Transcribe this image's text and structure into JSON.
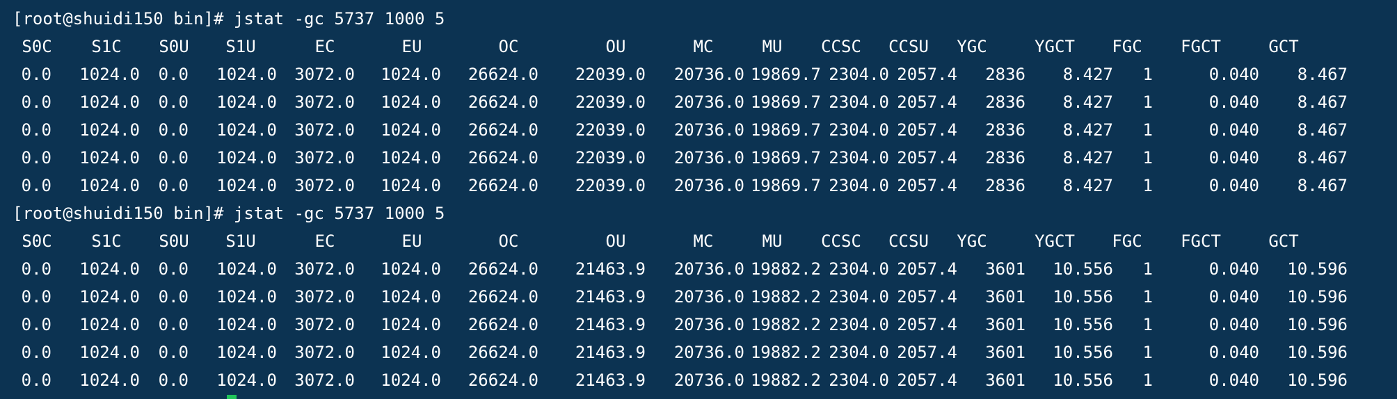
{
  "terminal": {
    "background": "#0c3352",
    "text_color": "#ffffff",
    "cursor_color": "#21c45a",
    "blocks": [
      {
        "prompt": "[root@shuidi150 bin]# jstat -gc 5737 1000 5",
        "headers": [
          "S0C",
          "S1C",
          "S0U",
          "S1U",
          "EC",
          "EU",
          "OC",
          "OU",
          "MC",
          "MU",
          "CCSC",
          "CCSU",
          "YGC",
          "YGCT",
          "FGC",
          "FGCT",
          "GCT"
        ],
        "rows": [
          [
            "0.0",
            "1024.0",
            "0.0",
            "1024.0",
            "3072.0",
            "1024.0",
            "26624.0",
            "22039.0",
            "20736.0",
            "19869.7",
            "2304.0",
            "2057.4",
            "2836",
            "8.427",
            "1",
            "0.040",
            "8.467"
          ],
          [
            "0.0",
            "1024.0",
            "0.0",
            "1024.0",
            "3072.0",
            "1024.0",
            "26624.0",
            "22039.0",
            "20736.0",
            "19869.7",
            "2304.0",
            "2057.4",
            "2836",
            "8.427",
            "1",
            "0.040",
            "8.467"
          ],
          [
            "0.0",
            "1024.0",
            "0.0",
            "1024.0",
            "3072.0",
            "1024.0",
            "26624.0",
            "22039.0",
            "20736.0",
            "19869.7",
            "2304.0",
            "2057.4",
            "2836",
            "8.427",
            "1",
            "0.040",
            "8.467"
          ],
          [
            "0.0",
            "1024.0",
            "0.0",
            "1024.0",
            "3072.0",
            "1024.0",
            "26624.0",
            "22039.0",
            "20736.0",
            "19869.7",
            "2304.0",
            "2057.4",
            "2836",
            "8.427",
            "1",
            "0.040",
            "8.467"
          ],
          [
            "0.0",
            "1024.0",
            "0.0",
            "1024.0",
            "3072.0",
            "1024.0",
            "26624.0",
            "22039.0",
            "20736.0",
            "19869.7",
            "2304.0",
            "2057.4",
            "2836",
            "8.427",
            "1",
            "0.040",
            "8.467"
          ]
        ]
      },
      {
        "prompt": "[root@shuidi150 bin]# jstat -gc 5737 1000 5",
        "headers": [
          "S0C",
          "S1C",
          "S0U",
          "S1U",
          "EC",
          "EU",
          "OC",
          "OU",
          "MC",
          "MU",
          "CCSC",
          "CCSU",
          "YGC",
          "YGCT",
          "FGC",
          "FGCT",
          "GCT"
        ],
        "rows": [
          [
            "0.0",
            "1024.0",
            "0.0",
            "1024.0",
            "3072.0",
            "1024.0",
            "26624.0",
            "21463.9",
            "20736.0",
            "19882.2",
            "2304.0",
            "2057.4",
            "3601",
            "10.556",
            "1",
            "0.040",
            "10.596"
          ],
          [
            "0.0",
            "1024.0",
            "0.0",
            "1024.0",
            "3072.0",
            "1024.0",
            "26624.0",
            "21463.9",
            "20736.0",
            "19882.2",
            "2304.0",
            "2057.4",
            "3601",
            "10.556",
            "1",
            "0.040",
            "10.596"
          ],
          [
            "0.0",
            "1024.0",
            "0.0",
            "1024.0",
            "3072.0",
            "1024.0",
            "26624.0",
            "21463.9",
            "20736.0",
            "19882.2",
            "2304.0",
            "2057.4",
            "3601",
            "10.556",
            "1",
            "0.040",
            "10.596"
          ],
          [
            "0.0",
            "1024.0",
            "0.0",
            "1024.0",
            "3072.0",
            "1024.0",
            "26624.0",
            "21463.9",
            "20736.0",
            "19882.2",
            "2304.0",
            "2057.4",
            "3601",
            "10.556",
            "1",
            "0.040",
            "10.596"
          ],
          [
            "0.0",
            "1024.0",
            "0.0",
            "1024.0",
            "3072.0",
            "1024.0",
            "26624.0",
            "21463.9",
            "20736.0",
            "19882.2",
            "2304.0",
            "2057.4",
            "3601",
            "10.556",
            "1",
            "0.040",
            "10.596"
          ]
        ]
      }
    ]
  }
}
